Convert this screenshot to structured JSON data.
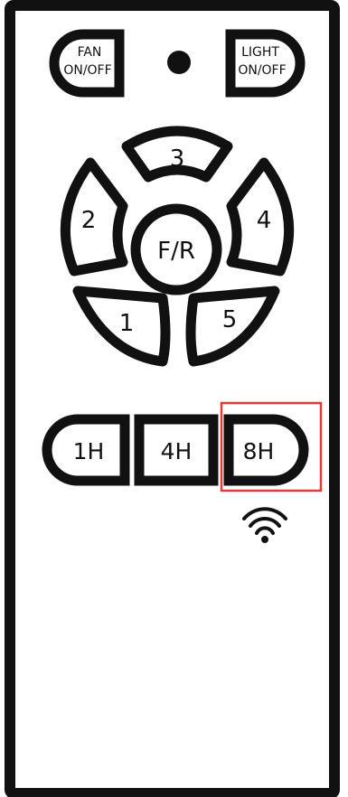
{
  "remote": {
    "colors": {
      "outline": "#111111",
      "background": "#ffffff",
      "highlight": "#e53935"
    },
    "fan_button": {
      "line1": "FAN",
      "line2": "ON/OFF"
    },
    "light_button": {
      "line1": "LIGHT",
      "line2": "ON/OFF"
    },
    "indicator": "status-led",
    "speed_buttons": {
      "s1": "1",
      "s2": "2",
      "s3": "3",
      "s4": "4",
      "s5": "5",
      "reverse": "F/R"
    },
    "timer_buttons": {
      "t1": "1H",
      "t4": "4H",
      "t8": "8H"
    },
    "highlighted_button": "8H",
    "signal_icon": "wifi-signal-icon"
  }
}
